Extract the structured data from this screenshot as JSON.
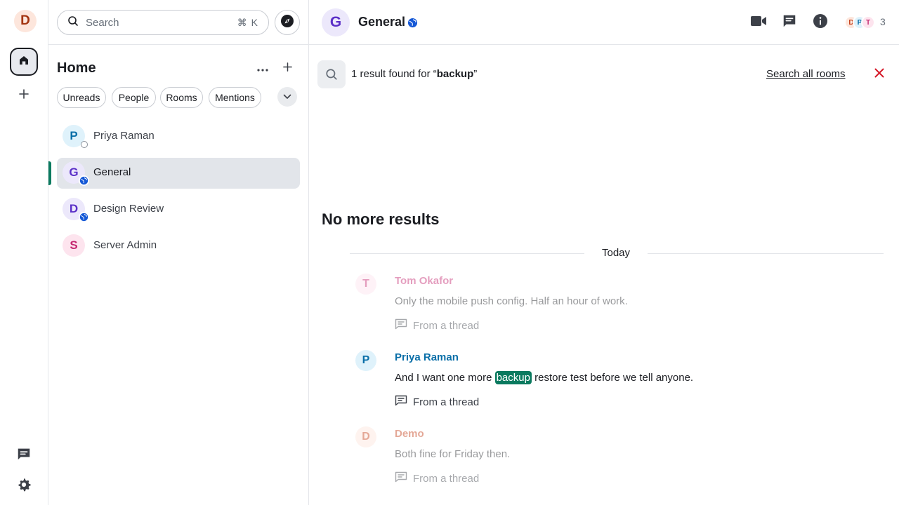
{
  "user": {
    "initial": "D"
  },
  "search": {
    "label": "Search",
    "shortcut": "⌘ K"
  },
  "home": {
    "title": "Home"
  },
  "filters": [
    "Unreads",
    "People",
    "Rooms",
    "Mentions"
  ],
  "rooms": [
    {
      "initial": "P",
      "name": "Priya Raman"
    },
    {
      "initial": "G",
      "name": "General"
    },
    {
      "initial": "D",
      "name": "Design Review"
    },
    {
      "initial": "S",
      "name": "Server Admin"
    }
  ],
  "header": {
    "avatar_initial": "G",
    "title": "General",
    "faces": [
      "D",
      "P",
      "T"
    ],
    "member_count": "3"
  },
  "results": {
    "prefix": "1 result found for “",
    "query": "backup",
    "suffix": "”",
    "search_all": "Search all rooms"
  },
  "timeline": {
    "no_more": "No more results",
    "date": "Today",
    "messages": [
      {
        "initial": "T",
        "sender": "Tom Okafor",
        "body": "Only the mobile push config. Half an hour of work.",
        "thread": "From a thread"
      },
      {
        "initial": "P",
        "sender": "Priya Raman",
        "body_before": "And I want one more ",
        "body_highlight": "backup",
        "body_after": " restore test before we tell anyone.",
        "thread": "From a thread"
      },
      {
        "initial": "D",
        "sender": "Demo",
        "body": "Both fine for Friday then.",
        "thread": "From a thread"
      }
    ]
  },
  "colors": {
    "accent": "#0b7a5f",
    "priya": "#0a6fa8",
    "general": "#5a2fc7",
    "design_review": "#5a2fc7",
    "server_admin": "#c42870",
    "tom": "#c42870",
    "demo": "#c5401b",
    "danger": "#d51928"
  }
}
